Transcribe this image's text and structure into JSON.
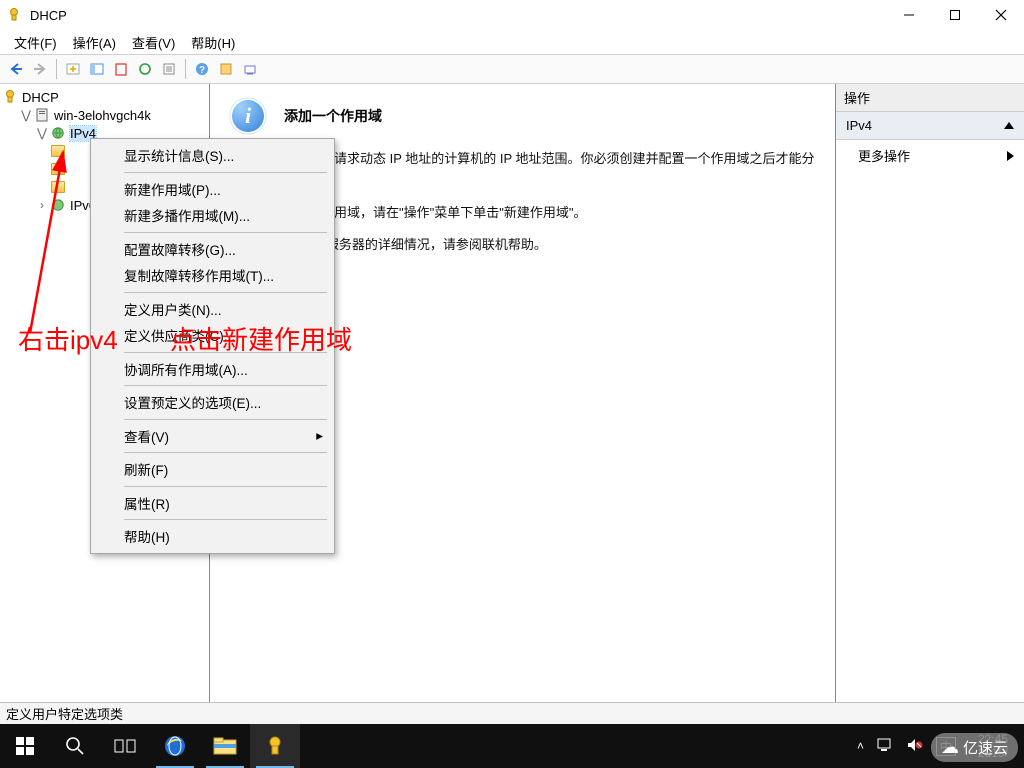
{
  "window": {
    "title": "DHCP"
  },
  "menubar": {
    "file": "文件(F)",
    "action": "操作(A)",
    "view": "查看(V)",
    "help": "帮助(H)"
  },
  "tree": {
    "root": "DHCP",
    "server": "win-3elohvgch4k",
    "ipv4": "IPv4",
    "ipv6": "IPv6"
  },
  "content": {
    "heading": "添加一个作用域",
    "p1": "作用域是指分配给请求动态 IP 地址的计算机的 IP 地址范围。你必须创建并配置一个作用域之后才能分配动态 IP 地址。",
    "p2": "若要添加一个新作用域，请在\"操作\"菜单下单击\"新建作用域\"。",
    "p3": "有关设置 DHCP 服务器的详细情况，请参阅联机帮助。"
  },
  "actions": {
    "header": "操作",
    "section": "IPv4",
    "more": "更多操作"
  },
  "context_menu": {
    "items": [
      "显示统计信息(S)...",
      "新建作用域(P)...",
      "新建多播作用域(M)...",
      "配置故障转移(G)...",
      "复制故障转移作用域(T)...",
      "定义用户类(N)...",
      "定义供应商类(C)...",
      "协调所有作用域(A)...",
      "设置预定义的选项(E)...",
      "查看(V)",
      "刷新(F)",
      "属性(R)",
      "帮助(H)"
    ]
  },
  "statusbar": {
    "text": "定义用户特定选项类"
  },
  "taskbar": {
    "time": "22:45",
    "date": "2019/"
  },
  "annotations": {
    "left": "右击ipv4",
    "right": "点击新建作用域"
  },
  "watermark": {
    "text": "亿速云"
  }
}
